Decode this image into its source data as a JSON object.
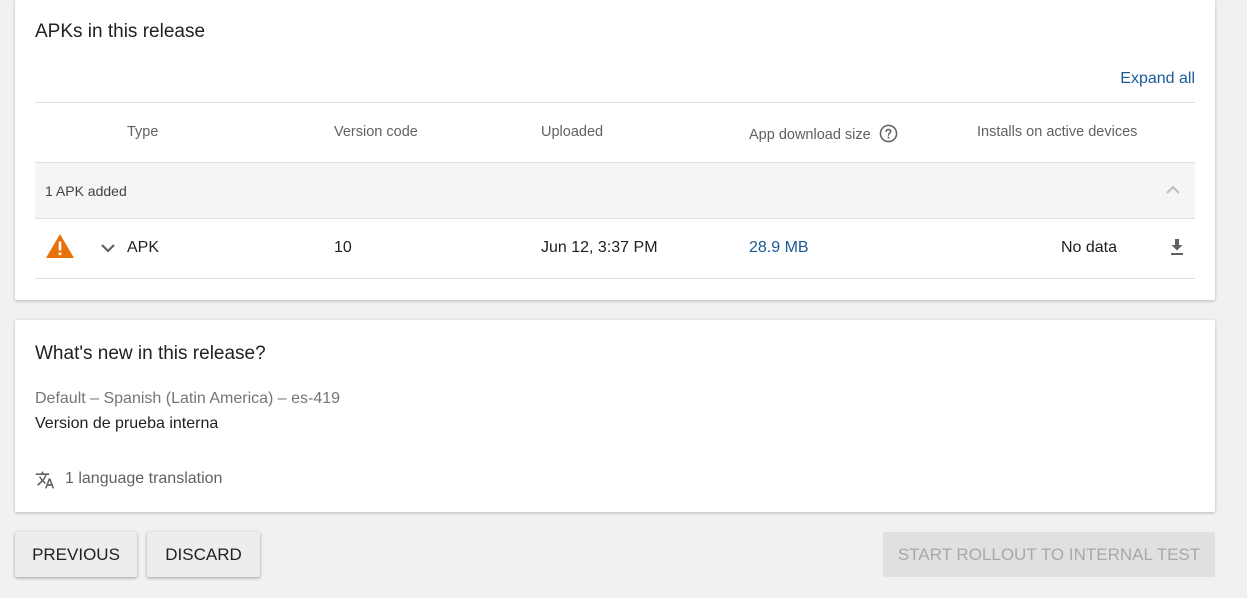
{
  "apk_section": {
    "title": "APKs in this release",
    "expand_all": "Expand all",
    "columns": {
      "type": "Type",
      "version_code": "Version code",
      "uploaded": "Uploaded",
      "download_size": "App download size",
      "installs": "Installs on active devices"
    },
    "group_label": "1 APK added",
    "rows": [
      {
        "type": "APK",
        "version_code": "10",
        "uploaded": "Jun 12, 3:37 PM",
        "download_size": "28.9 MB",
        "installs": "No data"
      }
    ]
  },
  "whats_new": {
    "title": "What's new in this release?",
    "locale": "Default – Spanish (Latin America) – es-419",
    "notes": "Version de prueba interna",
    "translations": "1 language translation"
  },
  "actions": {
    "previous": "PREVIOUS",
    "discard": "DISCARD",
    "rollout": "START ROLLOUT TO INTERNAL TEST"
  },
  "colors": {
    "link": "#1a5b98",
    "warning": "#e8710a",
    "background": "#f1f1f1"
  },
  "icons": {
    "warning": "warning-triangle-icon",
    "help": "help-circle-icon",
    "collapse": "chevron-up-icon",
    "expand_row": "chevron-down-icon",
    "download": "download-icon",
    "translate": "translate-icon"
  }
}
